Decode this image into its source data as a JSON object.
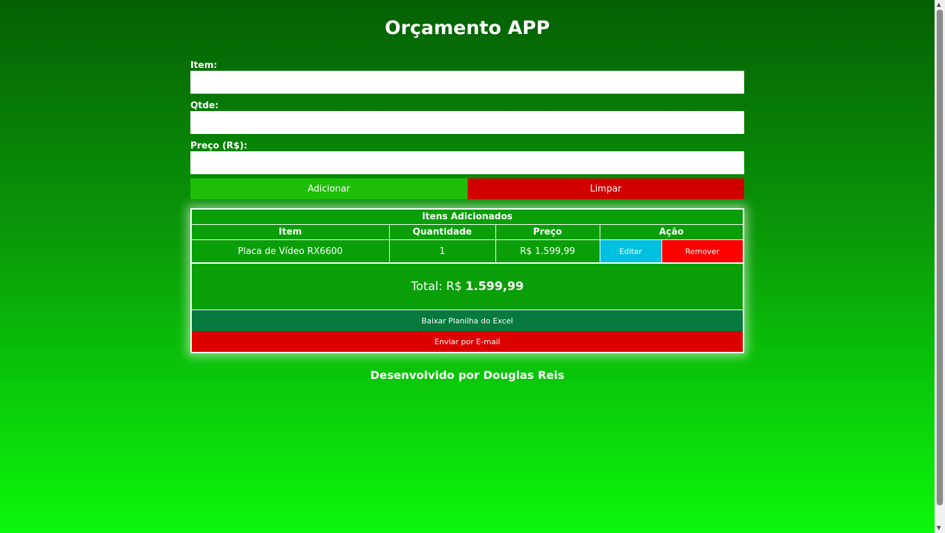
{
  "app": {
    "title": "Orçamento APP"
  },
  "form": {
    "item_label": "Item:",
    "qty_label": "Qtde:",
    "price_label": "Preço (R$):",
    "item_value": "",
    "qty_value": "",
    "price_value": "",
    "add_label": "Adicionar",
    "clear_label": "Limpar"
  },
  "table": {
    "caption": "Itens Adicionados",
    "headers": [
      "Item",
      "Quantidade",
      "Preço",
      "Ação"
    ],
    "rows": [
      {
        "item": "Placa de Vídeo RX6600",
        "quantidade": "1",
        "preco": "R$ 1.599,99",
        "edit_label": "Editar",
        "remove_label": "Remover"
      }
    ],
    "total_prefix": "Total: R$",
    "total_value": "1.599,99",
    "excel_label": "Baixar Planilha do Excel",
    "email_label": "Enviar por E-mail"
  },
  "footer": {
    "text": "Desenvolvido por Douglas Reis"
  },
  "colors": {
    "add": "#1fbe07",
    "clear": "#d10000",
    "edit": "#00c0e0",
    "remove": "#ff0000",
    "excel": "#067a3e",
    "email": "#dd0000"
  }
}
